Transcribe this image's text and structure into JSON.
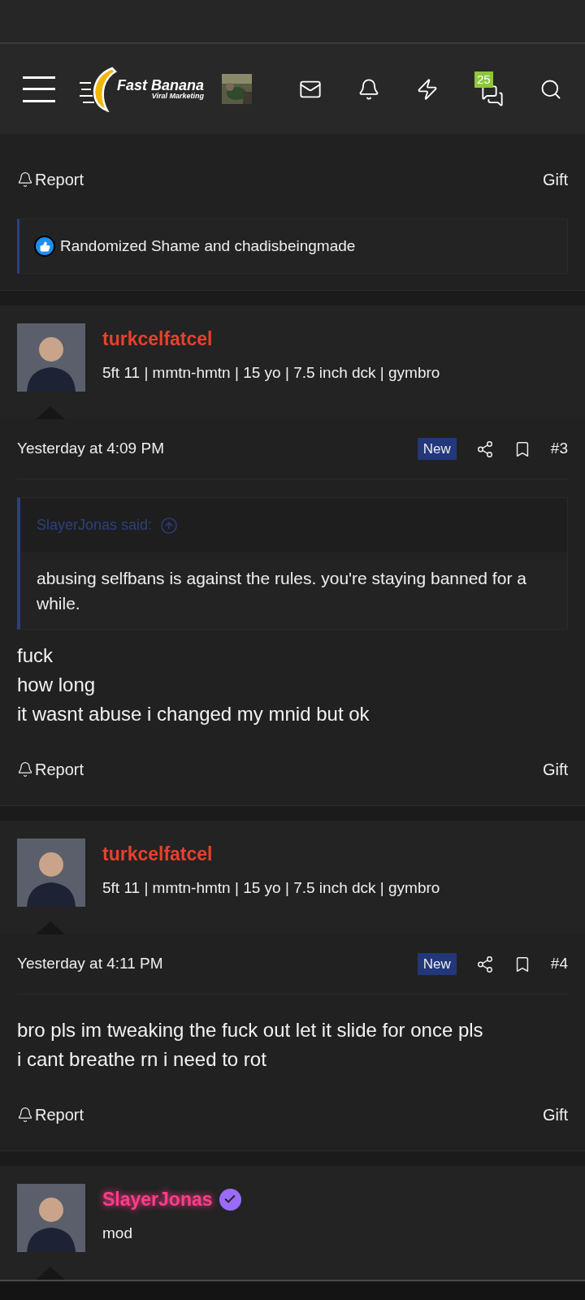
{
  "header": {
    "logo": {
      "title": "Fast Banana",
      "subtitle": "Viral Marketing"
    },
    "conversations_badge": "25"
  },
  "posts": [
    {
      "kind": "tail",
      "actions": {
        "report": "Report",
        "gift": "Gift"
      },
      "reactions": "Randomized Shame and chadisbeingmade"
    },
    {
      "kind": "full",
      "author": {
        "name": "turkcelfatcel",
        "color": "#e8412c",
        "title": "5ft 11 | mmtn-hmtn | 15 yo | 7.5 inch dck | gymbro",
        "verified": false
      },
      "time": "Yesterday at 4:09 PM",
      "new_badge": "New",
      "number": "#3",
      "quote": {
        "author": "SlayerJonas said:",
        "text": "abusing selfbans is against the rules. you're staying banned for a while."
      },
      "body": [
        "fuck",
        "how long",
        "it wasnt abuse i changed my mnid but ok"
      ],
      "actions": {
        "report": "Report",
        "gift": "Gift"
      }
    },
    {
      "kind": "full",
      "author": {
        "name": "turkcelfatcel",
        "color": "#e8412c",
        "title": "5ft 11 | mmtn-hmtn | 15 yo | 7.5 inch dck | gymbro",
        "verified": false
      },
      "time": "Yesterday at 4:11 PM",
      "new_badge": "New",
      "number": "#4",
      "body": [
        "bro pls im tweaking the fuck out let it slide for once pls",
        "i cant breathe rn i need to rot"
      ],
      "actions": {
        "report": "Report",
        "gift": "Gift"
      }
    },
    {
      "kind": "head",
      "author": {
        "name": "SlayerJonas",
        "color": "#ff3d8a",
        "title": "mod",
        "verified": true
      }
    }
  ]
}
